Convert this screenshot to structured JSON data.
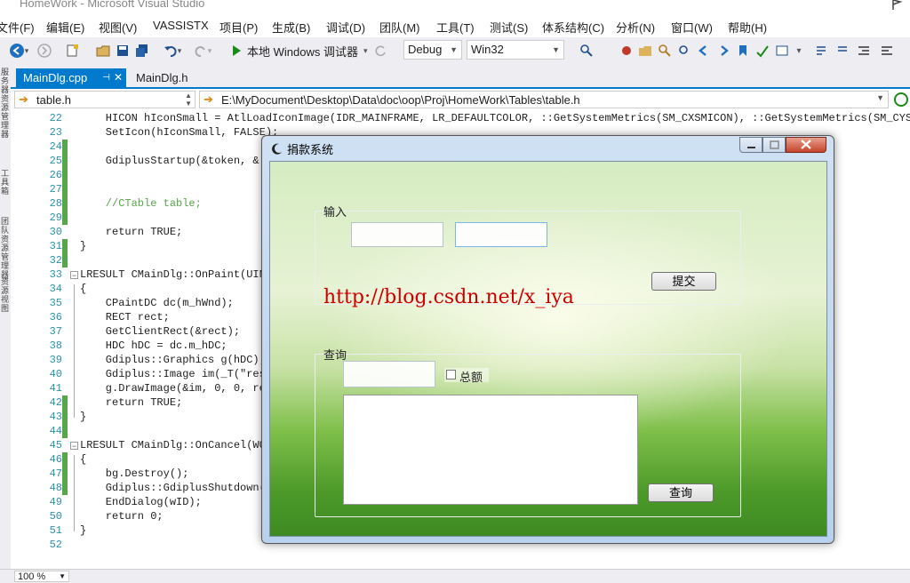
{
  "window": {
    "title": "HomeWork - Microsoft Visual Studio"
  },
  "menu": [
    "文件(F)",
    "编辑(E)",
    "视图(V)",
    "VASSISTX",
    "项目(P)",
    "生成(B)",
    "调试(D)",
    "团队(M)",
    "工具(T)",
    "测试(S)",
    "体系结构(C)",
    "分析(N)",
    "窗口(W)",
    "帮助(H)"
  ],
  "toolbar": {
    "run_label": "本地 Windows 调试器",
    "config": "Debug",
    "platform": "Win32"
  },
  "left_strip": [
    "服务器资源管理器",
    "工具箱",
    "团队资源管理器",
    "资源视图"
  ],
  "tabs": [
    {
      "label": "MainDlg.cpp"
    },
    {
      "label": "MainDlg.h"
    }
  ],
  "navbar": {
    "scope": "table.h",
    "path": "E:\\MyDocument\\Desktop\\Data\\doc\\oop\\Proj\\HomeWork\\Tables\\table.h"
  },
  "code_lines": [
    {
      "n": "22",
      "t": "    HICON hIconSmall = AtlLoadIconImage(IDR_MAINFRAME, LR_DEFAULTCOLOR, ::GetSystemMetrics(SM_CXSMICON), ::GetSystemMetrics(SM_CYSMI"
    },
    {
      "n": "23",
      "t": "    SetIcon(hIconSmall, FALSE);"
    },
    {
      "n": "24",
      "t": ""
    },
    {
      "n": "25",
      "t": "    GdiplusStartup(&token, &"
    },
    {
      "n": "26",
      "t": ""
    },
    {
      "n": "27",
      "t": ""
    },
    {
      "n": "28",
      "t": "    //CTable table;"
    },
    {
      "n": "29",
      "t": ""
    },
    {
      "n": "30",
      "t": "    return TRUE;"
    },
    {
      "n": "31",
      "t": "}"
    },
    {
      "n": "32",
      "t": ""
    },
    {
      "n": "33",
      "t": "LRESULT CMainDlg::OnPaint(UIN"
    },
    {
      "n": "34",
      "t": "{"
    },
    {
      "n": "35",
      "t": "    CPaintDC dc(m_hWnd);"
    },
    {
      "n": "36",
      "t": "    RECT rect;"
    },
    {
      "n": "37",
      "t": "    GetClientRect(&rect);"
    },
    {
      "n": "38",
      "t": "    HDC hDC = dc.m_hDC;"
    },
    {
      "n": "39",
      "t": "    Gdiplus::Graphics g(hDC);"
    },
    {
      "n": "40",
      "t": "    Gdiplus::Image im(_T(\"res"
    },
    {
      "n": "41",
      "t": "    g.DrawImage(&im, 0, 0, re"
    },
    {
      "n": "42",
      "t": "    return TRUE;"
    },
    {
      "n": "43",
      "t": "}"
    },
    {
      "n": "44",
      "t": ""
    },
    {
      "n": "45",
      "t": "LRESULT CMainDlg::OnCancel(WO"
    },
    {
      "n": "46",
      "t": "{"
    },
    {
      "n": "47",
      "t": "    bg.Destroy();"
    },
    {
      "n": "48",
      "t": "    Gdiplus::GdiplusShutdown("
    },
    {
      "n": "49",
      "t": "    EndDialog(wID);"
    },
    {
      "n": "50",
      "t": "    return 0;"
    },
    {
      "n": "51",
      "t": "}"
    },
    {
      "n": "52",
      "t": ""
    }
  ],
  "status": {
    "zoom": "100 %"
  },
  "dialog": {
    "title": "捐款系统",
    "input_group": "输入",
    "submit": "提交",
    "watermark": "http://blog.csdn.net/x_iya",
    "query_group": "查询",
    "total_checkbox": "总额",
    "query_button": "查询"
  },
  "colors": {
    "accent": "#007acc",
    "line_number": "#2b91af",
    "change_bar": "#57a64a",
    "watermark": "#cc0000"
  }
}
